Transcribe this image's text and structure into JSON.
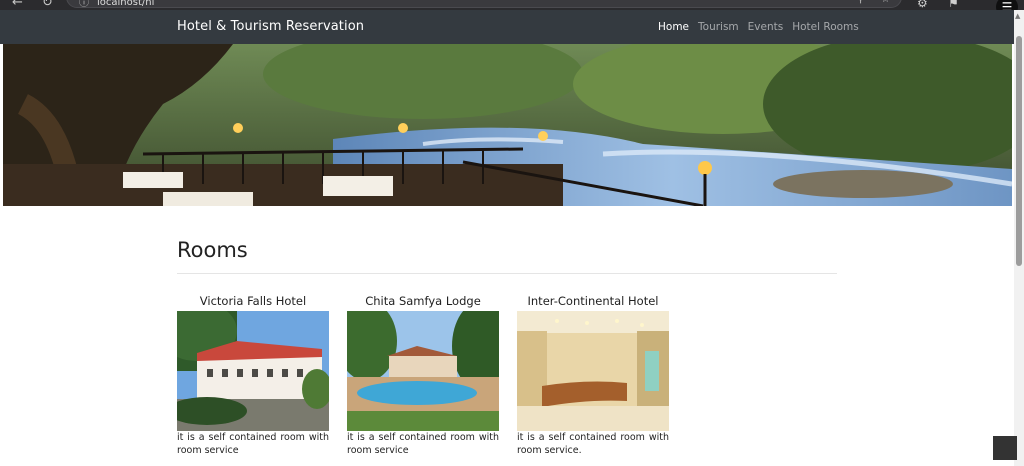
{
  "browser": {
    "url": "localhost/hi",
    "back_icon": "arrow-left-icon",
    "reload_icon": "reload-icon",
    "menu_icon": "hamburger-icon"
  },
  "navbar": {
    "brand": "Hotel & Tourism Reservation",
    "links": [
      {
        "label": "Home",
        "active": true
      },
      {
        "label": "Tourism",
        "active": false
      },
      {
        "label": "Events",
        "active": false
      },
      {
        "label": "Hotel Rooms",
        "active": false
      }
    ]
  },
  "section": {
    "title": "Rooms"
  },
  "rooms": [
    {
      "title": "Victoria Falls Hotel",
      "description": "it is a self contained room with room service"
    },
    {
      "title": "Chita Samfya Lodge",
      "description": "it is a self contained room with room service"
    },
    {
      "title": "Inter-Continental Hotel",
      "description": "it is a self contained room with room service."
    }
  ],
  "colors": {
    "navbar_bg": "#343a40",
    "button_primary": "#0d6efd"
  }
}
